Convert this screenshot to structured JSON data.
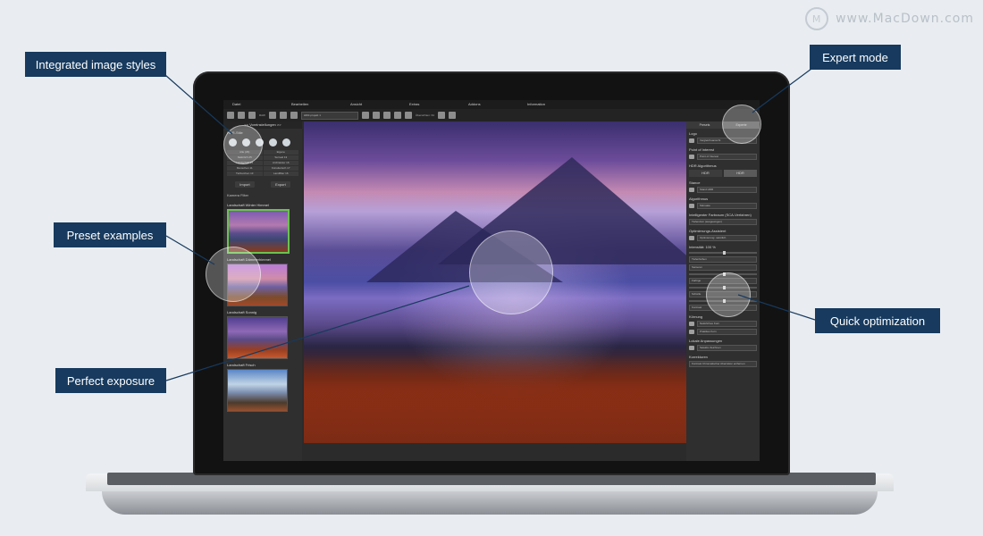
{
  "watermark": {
    "text": "www.MacDown.com"
  },
  "callouts": {
    "integrated_image_styles": "Integrated image styles",
    "expert_mode": "Expert mode",
    "preset_examples": "Preset examples",
    "perfect_exposure": "Perfect exposure",
    "quick_optimization": "Quick optimization"
  },
  "menu": [
    "Datei",
    "Bearbeiten",
    "Ansicht",
    "Extras",
    "Addons",
    "Information"
  ],
  "toolbar": {
    "project_select": "HDR-projekt 1",
    "raw_label": "RAW",
    "zoom_label": "Übersichten: 64"
  },
  "left_panel": {
    "title": "<< Voreinstellungen >>",
    "section_label": "HDR-Stile",
    "style_grid": [
      "Alle (29)",
      "Eigene",
      "Natürlich 25",
      "Surreal 13",
      "Landschaft 15",
      "Architektur 16",
      "Menschen 11",
      "Künstlerisch 17",
      "Tiefzeichen 13",
      "Landfilter 16"
    ],
    "import_label": "Import",
    "export_label": "Export",
    "filter_label": "Kamera Filter",
    "presets": [
      {
        "label": "Landschaft Winter Himmel"
      },
      {
        "label": "Landschaft Dämmerhimmel"
      },
      {
        "label": "Landschaft Sonnig"
      },
      {
        "label": "Landschaft Frisch"
      }
    ]
  },
  "right_panel": {
    "tabs": [
      "Presets",
      "Experte"
    ],
    "logo_label": "Logo",
    "logo_value": "Vergleichsansicht",
    "poi_label": "Point of Interest",
    "poi_value": "Point of Interest",
    "hdr_algo_label": "HDR Algorithmus",
    "hdr_btn1": "HDR",
    "hdr_btn2": "HDR",
    "stance_label": "Stance",
    "stance_value": "Stand HDR",
    "algo_label": "Algorithmus",
    "algo_value": "Stimuate",
    "ai_label": "Intelligenter Farbraum (SCA-Verfahren)",
    "ai_value": "Tiefendom (ausgewogen)",
    "opt_label": "Optimierungs-Assistent",
    "opt_value": "Optimierung: natürlich",
    "slider_label": "Intensität: 100 %",
    "btns": [
      "Tiefenfarben",
      "Sanieren",
      "Farbige",
      "Schärfe",
      "Kontrast"
    ],
    "kornung_label": "Körnung",
    "kornung_1": "Natürliches Korn",
    "kornung_2": "Praktiles Korn",
    "lokale_label": "Lokale Anpassungen",
    "lokale_value": "Selektiv Zeichnen",
    "korrektur_label": "Korrekturen",
    "korrektur_value": "Kontrast Chromatischer Aberration entfernen"
  }
}
